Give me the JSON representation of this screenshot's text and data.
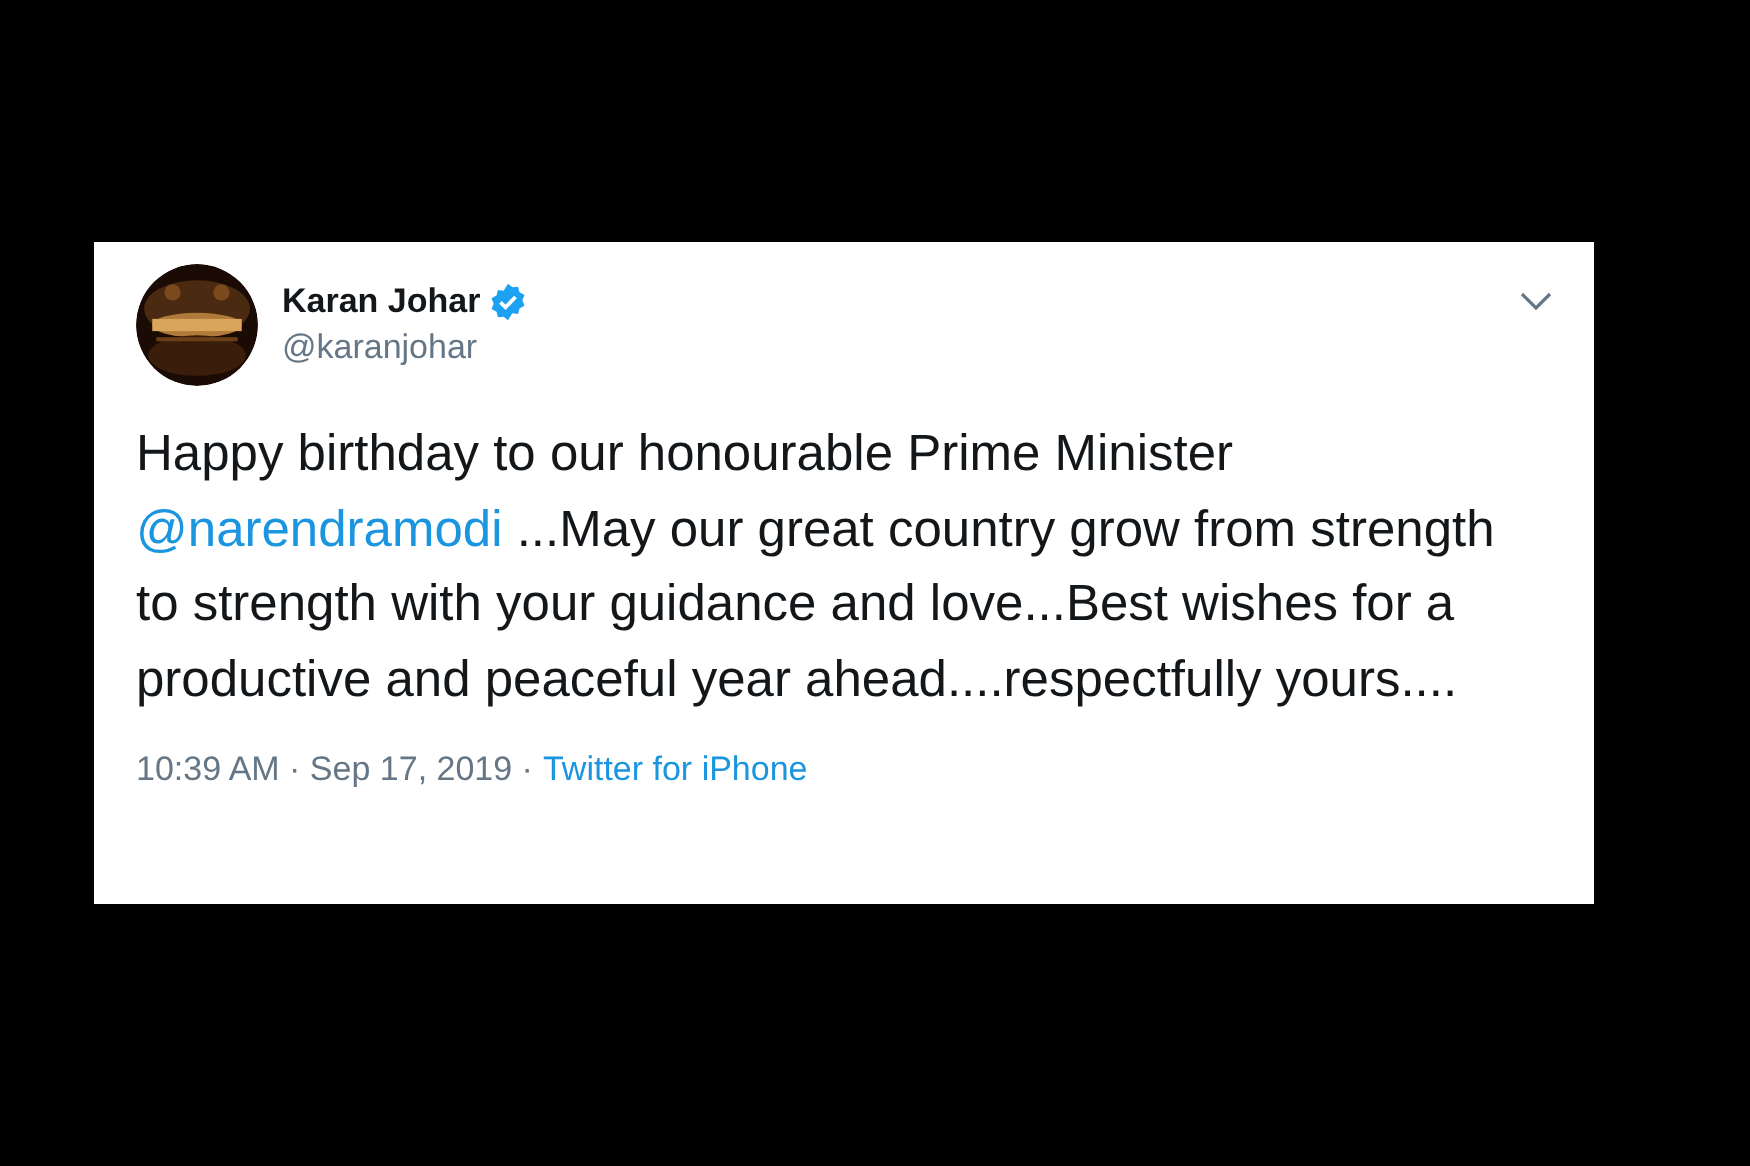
{
  "tweet": {
    "author": {
      "name": "Karan Johar",
      "verified": true,
      "handle": "@karanjohar"
    },
    "text_parts": [
      {
        "kind": "text",
        "text": "Happy birthday to our honourable Prime Minister "
      },
      {
        "kind": "mention",
        "text": "@narendramodi"
      },
      {
        "kind": "text",
        "text": " ...May our great country grow from strength to strength with your guidance and love...Best wishes for a productive and peaceful year ahead....respectfully yours...."
      }
    ],
    "time": "10:39 AM · Sep 17, 2019 ·",
    "source": "Twitter for iPhone"
  }
}
